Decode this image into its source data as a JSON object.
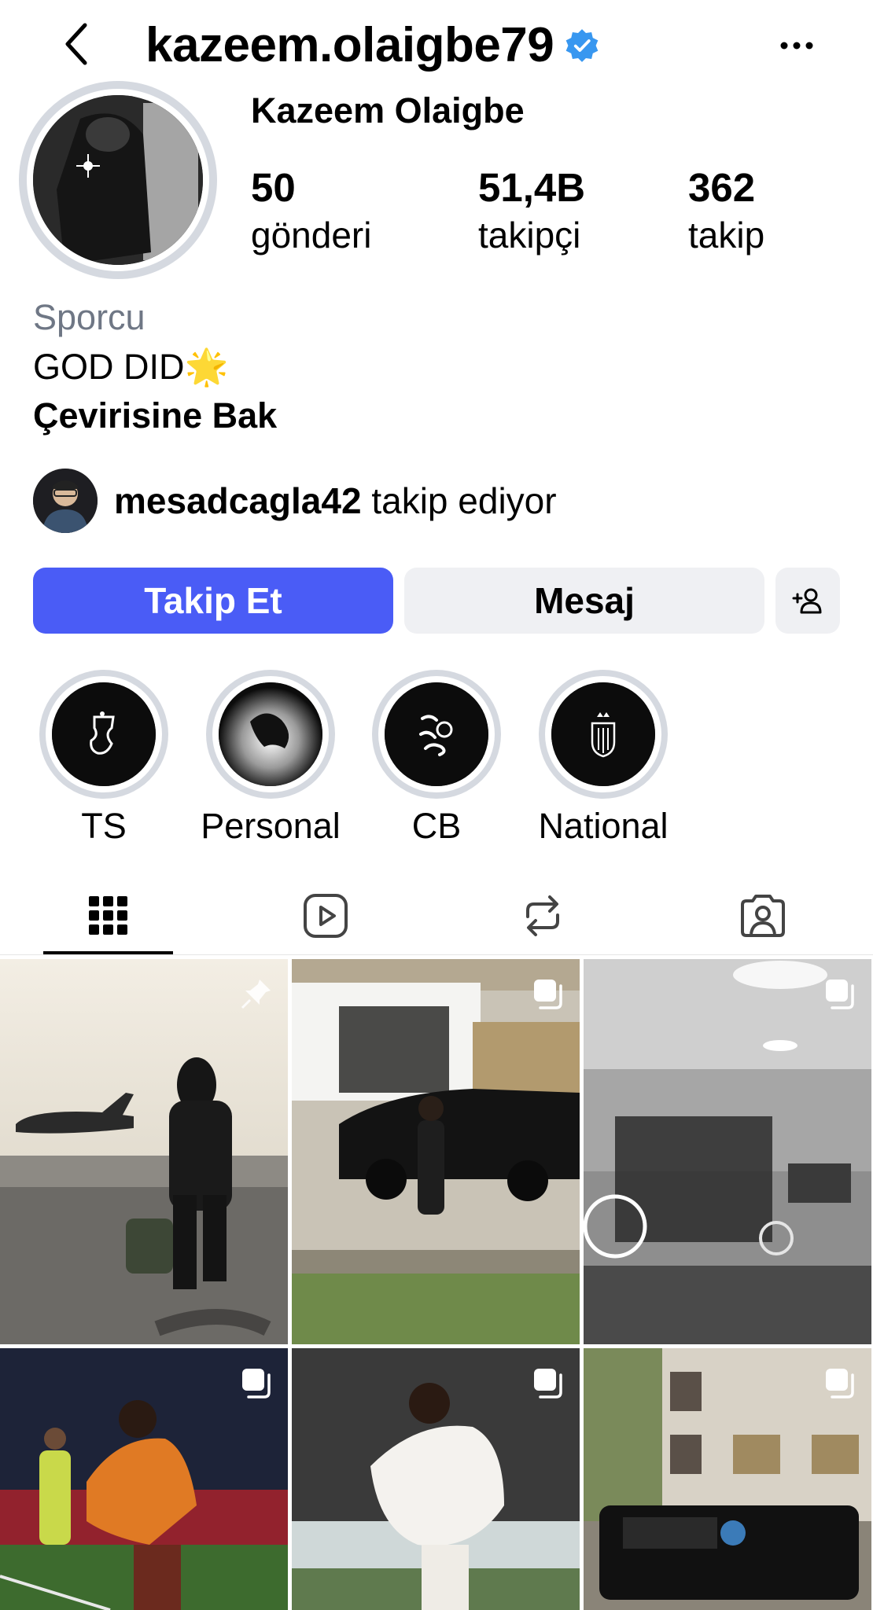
{
  "header": {
    "username": "kazeem.olaigbe79",
    "back_icon": "chevron-left-icon",
    "verified_icon": "verified-badge-icon",
    "more_icon": "more-horizontal-icon"
  },
  "profile": {
    "full_name": "Kazeem Olaigbe",
    "stats": [
      {
        "value": "50",
        "label": "gönderi"
      },
      {
        "value": "51,4B",
        "label": "takipçi"
      },
      {
        "value": "362",
        "label": "takip"
      }
    ],
    "category": "Sporcu",
    "bio": "GOD DID🌟",
    "translate_label": "Çevirisine Bak",
    "followed_by": {
      "username": "mesadcagla42",
      "suffix": " takip ediyor"
    }
  },
  "actions": {
    "follow_label": "Takip Et",
    "message_label": "Mesaj",
    "add_icon": "add-person-icon"
  },
  "highlights": [
    {
      "label": "TS"
    },
    {
      "label": "Personal"
    },
    {
      "label": "CB"
    },
    {
      "label": "National"
    }
  ],
  "tabs": [
    {
      "icon": "grid-icon",
      "active": true
    },
    {
      "icon": "reels-icon",
      "active": false
    },
    {
      "icon": "reposts-icon",
      "active": false
    },
    {
      "icon": "tagged-icon",
      "active": false
    }
  ],
  "colors": {
    "accent": "#4a5cf6",
    "verified": "#3897f0",
    "secondary_text": "#6f7785",
    "button_gray": "#eff0f3"
  }
}
